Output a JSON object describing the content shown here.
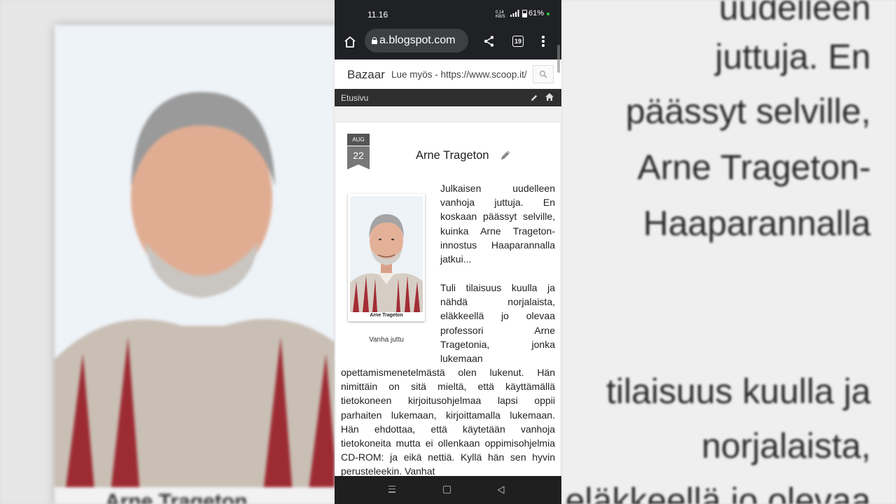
{
  "status": {
    "time": "11.16",
    "net_speed": "0.14\nKB/S",
    "signal": "5G",
    "battery": "61%"
  },
  "browser": {
    "url": "a.blogspot.com",
    "tabs_count": "19"
  },
  "blog": {
    "title": "Bazaar",
    "marquee": "Lue myös - https://www.scoop.it/",
    "nav_home": "Etusivu"
  },
  "post": {
    "month": "AUG",
    "day": "22",
    "title": "Arne Trageton",
    "photo_inner_caption": "Arne Trageton",
    "photo_caption": "Vanha juttu",
    "para1": "Julkaisen uudelleen vanhoja juttuja. En koskaan päässyt selville, kuinka Arne Trageton-innostus Haaparannalla jatkui...",
    "para2": "Tuli tilaisuus kuulla ja nähdä norjalaista, eläkkeellä jo olevaa professori Arne Tragetonia, jonka lukemaan",
    "para3": "opettamismenetelmästä olen lukenut. Hän nimittäin on sitä mieltä, että käyttämällä tietokoneen kirjoitusohjelmaa lapsi oppii parhaiten lukemaan, kirjoittamalla lukemaan. Hän ehdottaa, että käytetään vanhoja tietokoneita mutta ei ollenkaan oppimisohjelmia CD-ROM: ja eikä nettiä. Kyllä hän sen hyvin perusteleekin. Vanhat"
  },
  "background": {
    "left_caption": "Arne Trageton",
    "right_lines": [
      "uudelleen",
      "juttuja. En",
      "päässyt selville,",
      "Arne Trageton-",
      "Haaparannalla",
      "tilaisuus kuulla ja",
      "norjalaista,",
      "eläkkeellä jo olevaa"
    ]
  }
}
